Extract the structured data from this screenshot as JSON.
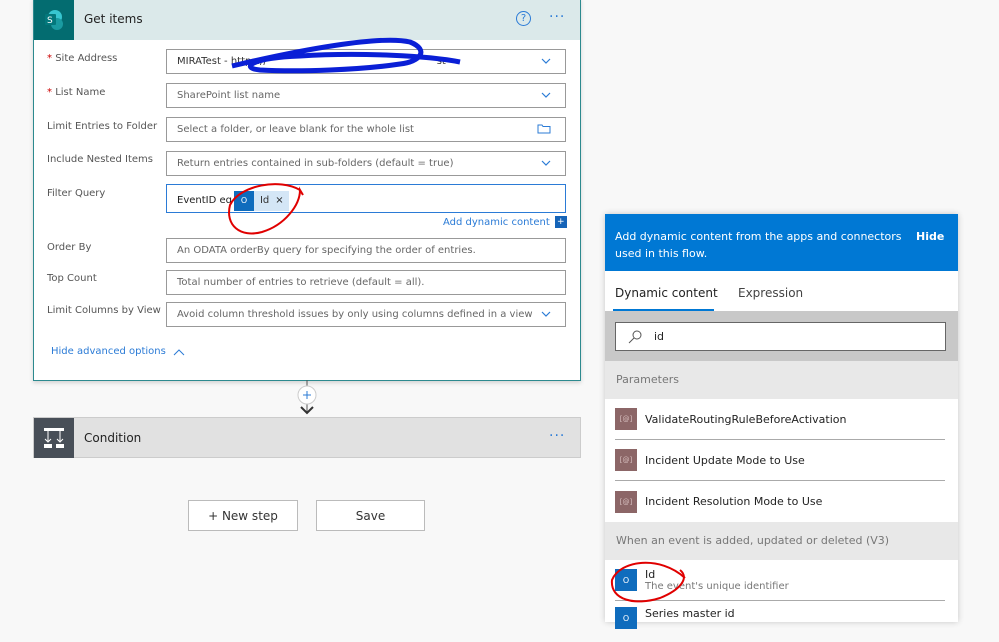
{
  "card": {
    "title": "Get items",
    "help_icon": "?",
    "more": "···",
    "fields": [
      {
        "label": "Site Address",
        "required": true,
        "value": "MIRATest - https://",
        "value_tail": "st",
        "dropdown": true
      },
      {
        "label": "List Name",
        "required": true,
        "placeholder": "SharePoint list name",
        "dropdown": true
      },
      {
        "label": "Limit Entries to Folder",
        "placeholder": "Select a folder, or leave blank for the whole list",
        "icon": "folder-icon"
      },
      {
        "label": "Include Nested Items",
        "placeholder": "Return entries contained in sub-folders (default = true)",
        "dropdown": true
      },
      {
        "label": "Filter Query",
        "value": "EventID eq",
        "token": "Id",
        "token_close": "×"
      },
      {
        "label": "Order By",
        "placeholder": "An ODATA orderBy query for specifying the order of entries."
      },
      {
        "label": "Top Count",
        "placeholder": "Total number of entries to retrieve (default = all)."
      },
      {
        "label": "Limit Columns by View",
        "placeholder": "Avoid column threshold issues by only using columns defined in a view",
        "dropdown": true
      }
    ],
    "add_dynamic": "Add dynamic content",
    "add_dynamic_icon": "+",
    "hide_advanced": "Hide advanced options"
  },
  "condition": {
    "title": "Condition",
    "more": "···"
  },
  "buttons": {
    "new_step": "+ New step",
    "save": "Save"
  },
  "panel": {
    "header": "Add dynamic content from the apps and connectors used in this flow.",
    "hide": "Hide",
    "tabs": [
      "Dynamic content",
      "Expression"
    ],
    "active_tab": "Dynamic content",
    "search_value": "id",
    "sections": [
      {
        "title": "Parameters",
        "items": [
          "ValidateRoutingRuleBeforeActivation",
          "Incident Update Mode to Use",
          "Incident Resolution Mode to Use"
        ]
      },
      {
        "title": "When an event is added, updated or deleted (V3)",
        "items": [
          {
            "name": "Id",
            "desc": "The event's unique identifier"
          },
          {
            "name": "Series master id"
          }
        ]
      }
    ]
  },
  "colors": {
    "accent": "#0078d4",
    "sharepoint": "#036c70",
    "parameter_icon": "#8c6667",
    "annotation_red": "#e00000",
    "scribble_blue": "#0a1fd6"
  }
}
